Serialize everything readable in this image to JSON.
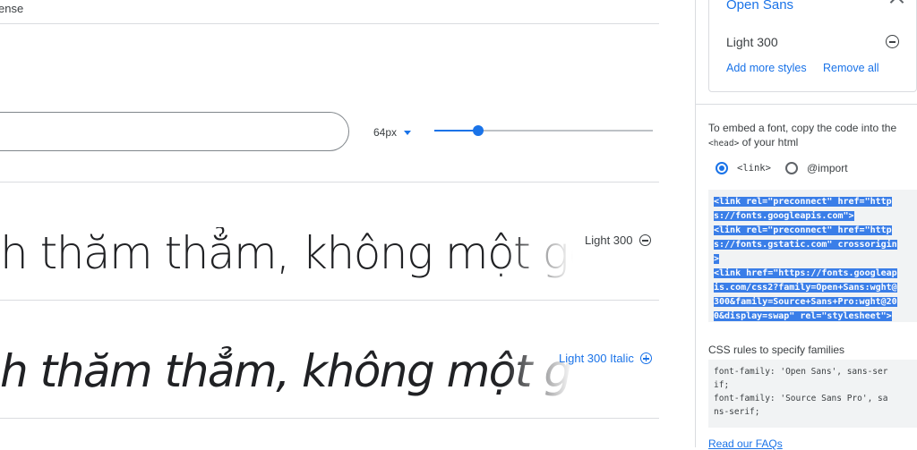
{
  "main": {
    "top_tab": "ense",
    "size": {
      "label": "64px",
      "value_fraction": 0.2
    },
    "previews": [
      {
        "text": "h thăm thẳm, không một gợ",
        "style_label": "Light 300",
        "selected": true
      },
      {
        "text": "h thăm thẳm, không một gợ",
        "style_label": "Light 300 Italic",
        "selected": false
      }
    ]
  },
  "panel": {
    "family_name": "Open Sans",
    "selected_style": "Light 300",
    "add_more": "Add more styles",
    "remove_all": "Remove all",
    "embed_intro_1": "To embed a font, copy the code into the",
    "embed_head_tag": "<head>",
    "embed_intro_2": " of your html",
    "radio_link": "<link>",
    "radio_import": "@import",
    "code_lines": [
      "<link rel=\"preconnect\" href=\"http",
      "s://fonts.googleapis.com\">",
      "<link rel=\"preconnect\" href=\"http",
      "s://fonts.gstatic.com\" crossorigin",
      ">",
      "<link href=\"https://fonts.googleap",
      "is.com/css2?family=Open+Sans:wght@",
      "300&family=Source+Sans+Pro:wght@20",
      "0&display=swap\" rel=\"stylesheet\">"
    ],
    "css_title": "CSS rules to specify families",
    "css_lines": [
      "font-family: 'Open Sans', sans-ser",
      "if;",
      "font-family: 'Source Sans Pro', sa",
      "ns-serif;"
    ],
    "faq": "Read our FAQs"
  },
  "colors": {
    "accent": "#1a73e8",
    "selection": "#3a7ee8",
    "divider": "#dadce0"
  }
}
